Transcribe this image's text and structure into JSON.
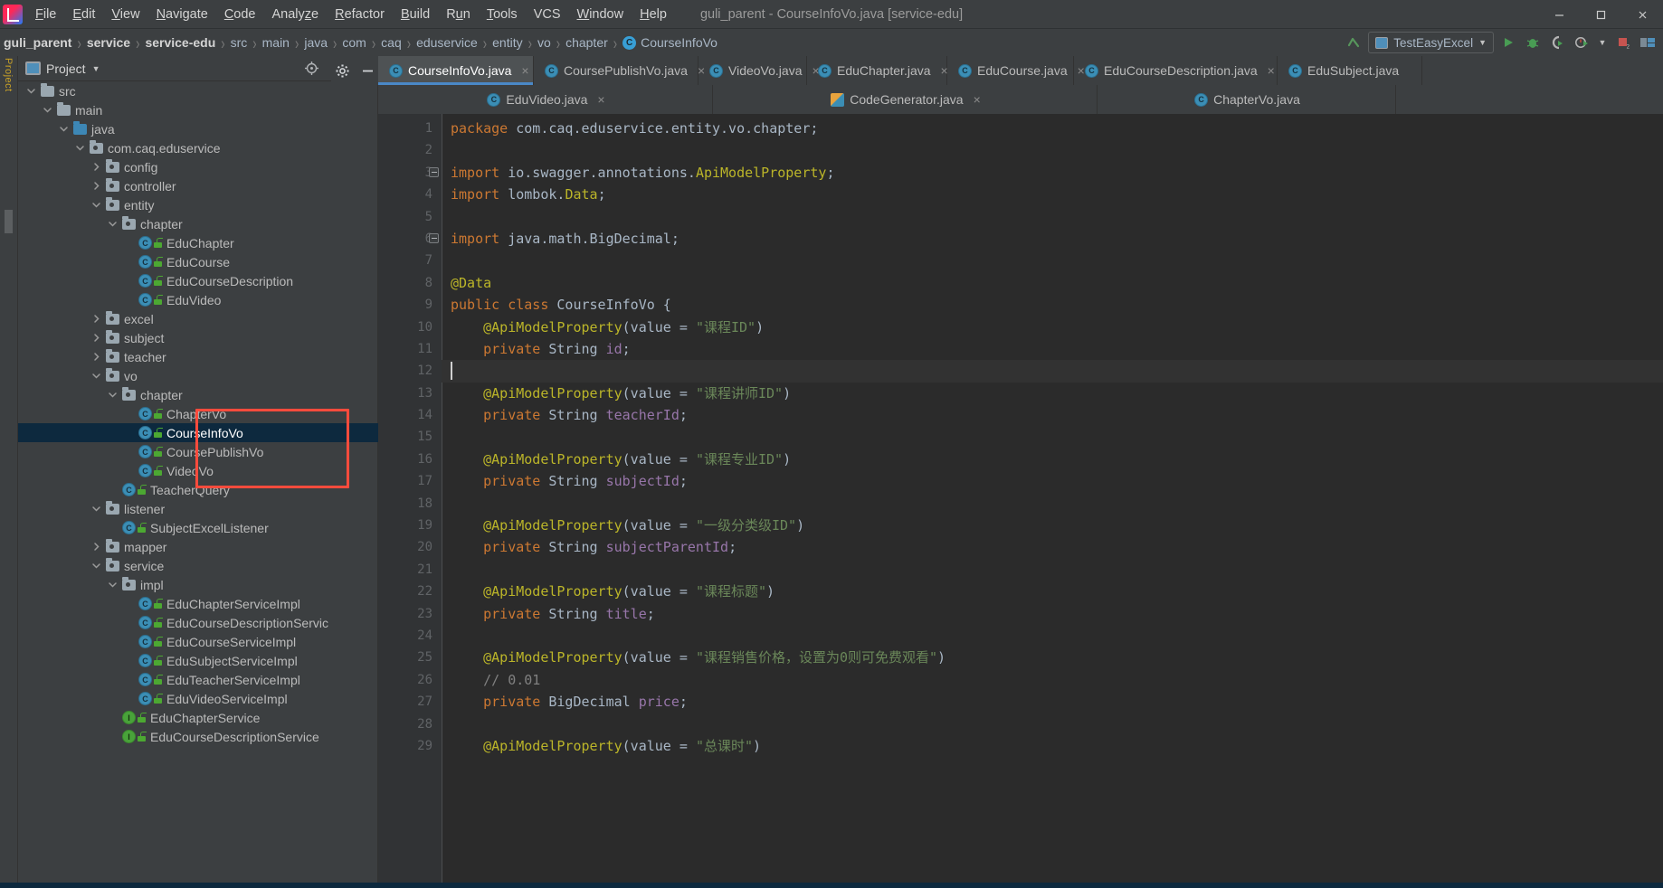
{
  "window": {
    "title": "guli_parent - CourseInfoVo.java [service-edu]",
    "logo_name": "intellij-idea-logo",
    "minimize": "minimize",
    "maximize": "maximize",
    "close": "close"
  },
  "menu": [
    {
      "label": "File",
      "mnemonic": "F"
    },
    {
      "label": "Edit",
      "mnemonic": "E"
    },
    {
      "label": "View",
      "mnemonic": "V"
    },
    {
      "label": "Navigate",
      "mnemonic": "N"
    },
    {
      "label": "Code",
      "mnemonic": "C"
    },
    {
      "label": "Analyze",
      "mnemonic": "z"
    },
    {
      "label": "Refactor",
      "mnemonic": "R"
    },
    {
      "label": "Build",
      "mnemonic": "B"
    },
    {
      "label": "Run",
      "mnemonic": "u"
    },
    {
      "label": "Tools",
      "mnemonic": "T"
    },
    {
      "label": "VCS",
      "mnemonic": ""
    },
    {
      "label": "Window",
      "mnemonic": "W"
    },
    {
      "label": "Help",
      "mnemonic": "H"
    }
  ],
  "breadcrumb": [
    {
      "label": "guli_parent",
      "bold": true,
      "icon": ""
    },
    {
      "label": "service",
      "bold": true,
      "icon": ""
    },
    {
      "label": "service-edu",
      "bold": true,
      "icon": ""
    },
    {
      "label": "src",
      "bold": false,
      "icon": ""
    },
    {
      "label": "main",
      "bold": false,
      "icon": ""
    },
    {
      "label": "java",
      "bold": false,
      "icon": ""
    },
    {
      "label": "com",
      "bold": false,
      "icon": ""
    },
    {
      "label": "caq",
      "bold": false,
      "icon": ""
    },
    {
      "label": "eduservice",
      "bold": false,
      "icon": ""
    },
    {
      "label": "entity",
      "bold": false,
      "icon": ""
    },
    {
      "label": "vo",
      "bold": false,
      "icon": ""
    },
    {
      "label": "chapter",
      "bold": false,
      "icon": ""
    },
    {
      "label": "CourseInfoVo",
      "bold": false,
      "icon": "C"
    }
  ],
  "toolbar": {
    "back_icon": "back-arrow-icon",
    "run_config": "TestEasyExcel",
    "run_config_dropdown": "chevron-down-icon",
    "run_icon": "run-icon",
    "debug_icon": "debug-icon",
    "run_coverage_icon": "run-with-coverage-icon",
    "profiler_icon": "profiler-icon",
    "profiler_dropdown": "chevron-down-icon",
    "stop_icon": "stop-icon",
    "layout_icon": "layout-icon"
  },
  "project_panel": {
    "title": "Project",
    "dropdown_icon": "chevron-down-icon",
    "panel_icon": "project-view-icon",
    "actions": [
      {
        "name": "locate-icon"
      },
      {
        "name": "expand-all-icon"
      },
      {
        "name": "collapse-all-icon"
      },
      {
        "name": "settings-gear-icon"
      },
      {
        "name": "hide-icon"
      }
    ],
    "left_strip_label": "Project"
  },
  "tree": [
    {
      "label": "src",
      "indent": 3,
      "arrow": "down",
      "icon": "folder",
      "selected": false
    },
    {
      "label": "main",
      "indent": 4,
      "arrow": "down",
      "icon": "folder",
      "selected": false
    },
    {
      "label": "java",
      "indent": 5,
      "arrow": "down",
      "icon": "folder-blue",
      "selected": false
    },
    {
      "label": "com.caq.eduservice",
      "indent": 6,
      "arrow": "down",
      "icon": "package",
      "selected": false
    },
    {
      "label": "config",
      "indent": 7,
      "arrow": "right",
      "icon": "package",
      "selected": false
    },
    {
      "label": "controller",
      "indent": 7,
      "arrow": "right",
      "icon": "package",
      "selected": false
    },
    {
      "label": "entity",
      "indent": 7,
      "arrow": "down",
      "icon": "package",
      "selected": false
    },
    {
      "label": "chapter",
      "indent": 8,
      "arrow": "down",
      "icon": "package",
      "selected": false
    },
    {
      "label": "EduChapter",
      "indent": 9,
      "arrow": "none",
      "icon": "class",
      "selected": false
    },
    {
      "label": "EduCourse",
      "indent": 9,
      "arrow": "none",
      "icon": "class",
      "selected": false
    },
    {
      "label": "EduCourseDescription",
      "indent": 9,
      "arrow": "none",
      "icon": "class",
      "selected": false
    },
    {
      "label": "EduVideo",
      "indent": 9,
      "arrow": "none",
      "icon": "class",
      "selected": false
    },
    {
      "label": "excel",
      "indent": 7,
      "arrow": "right",
      "icon": "package",
      "selected": false
    },
    {
      "label": "subject",
      "indent": 7,
      "arrow": "right",
      "icon": "package",
      "selected": false
    },
    {
      "label": "teacher",
      "indent": 7,
      "arrow": "right",
      "icon": "package",
      "selected": false
    },
    {
      "label": "vo",
      "indent": 7,
      "arrow": "down",
      "icon": "package",
      "selected": false
    },
    {
      "label": "chapter",
      "indent": 8,
      "arrow": "down",
      "icon": "package",
      "selected": false
    },
    {
      "label": "ChapterVo",
      "indent": 9,
      "arrow": "none",
      "icon": "class",
      "selected": false
    },
    {
      "label": "CourseInfoVo",
      "indent": 9,
      "arrow": "none",
      "icon": "class",
      "selected": true
    },
    {
      "label": "CoursePublishVo",
      "indent": 9,
      "arrow": "none",
      "icon": "class",
      "selected": false
    },
    {
      "label": "VideoVo",
      "indent": 9,
      "arrow": "none",
      "icon": "class",
      "selected": false
    },
    {
      "label": "TeacherQuery",
      "indent": 8,
      "arrow": "none",
      "icon": "class",
      "selected": false
    },
    {
      "label": "listener",
      "indent": 7,
      "arrow": "down",
      "icon": "package",
      "selected": false
    },
    {
      "label": "SubjectExcelListener",
      "indent": 8,
      "arrow": "none",
      "icon": "class",
      "selected": false
    },
    {
      "label": "mapper",
      "indent": 7,
      "arrow": "right",
      "icon": "package",
      "selected": false
    },
    {
      "label": "service",
      "indent": 7,
      "arrow": "down",
      "icon": "package",
      "selected": false
    },
    {
      "label": "impl",
      "indent": 8,
      "arrow": "down",
      "icon": "package",
      "selected": false
    },
    {
      "label": "EduChapterServiceImpl",
      "indent": 9,
      "arrow": "none",
      "icon": "class",
      "selected": false
    },
    {
      "label": "EduCourseDescriptionServic",
      "indent": 9,
      "arrow": "none",
      "icon": "class",
      "selected": false
    },
    {
      "label": "EduCourseServiceImpl",
      "indent": 9,
      "arrow": "none",
      "icon": "class",
      "selected": false
    },
    {
      "label": "EduSubjectServiceImpl",
      "indent": 9,
      "arrow": "none",
      "icon": "class",
      "selected": false
    },
    {
      "label": "EduTeacherServiceImpl",
      "indent": 9,
      "arrow": "none",
      "icon": "class",
      "selected": false
    },
    {
      "label": "EduVideoServiceImpl",
      "indent": 9,
      "arrow": "none",
      "icon": "class",
      "selected": false
    },
    {
      "label": "EduChapterService",
      "indent": 8,
      "arrow": "none",
      "icon": "interface",
      "selected": false
    },
    {
      "label": "EduCourseDescriptionService",
      "indent": 8,
      "arrow": "none",
      "icon": "interface",
      "selected": false
    }
  ],
  "editor_tabs_row1": [
    {
      "label": "CourseInfoVo.java",
      "icon": "class",
      "active": true,
      "close": "×"
    },
    {
      "label": "CoursePublishVo.java",
      "icon": "class",
      "active": false,
      "close": "×"
    },
    {
      "label": "VideoVo.java",
      "icon": "class",
      "active": false,
      "close": "×"
    },
    {
      "label": "EduChapter.java",
      "icon": "class",
      "active": false,
      "close": "×"
    },
    {
      "label": "EduCourse.java",
      "icon": "class",
      "active": false,
      "close": "×"
    },
    {
      "label": "EduCourseDescription.java",
      "icon": "class",
      "active": false,
      "close": "×"
    },
    {
      "label": "EduSubject.java",
      "icon": "class",
      "active": false,
      "close": ""
    }
  ],
  "editor_tabs_row2": [
    {
      "label": "EduVideo.java",
      "icon": "class",
      "active": false,
      "close": "×"
    },
    {
      "label": "CodeGenerator.java",
      "icon": "generator",
      "active": false,
      "close": "×"
    },
    {
      "label": "ChapterVo.java",
      "icon": "class",
      "active": false,
      "close": ""
    }
  ],
  "code": {
    "first_line": 1,
    "caret_line": 12,
    "fold_lines": [
      3,
      6
    ],
    "lines": [
      {
        "n": 1,
        "tokens": [
          {
            "t": "k",
            "v": "package"
          },
          {
            "t": "t",
            "v": " com.caq.eduservice.entity.vo.chapter;"
          }
        ]
      },
      {
        "n": 2,
        "tokens": []
      },
      {
        "n": 3,
        "tokens": [
          {
            "t": "k",
            "v": "import"
          },
          {
            "t": "t",
            "v": " io.swagger.annotations."
          },
          {
            "t": "an",
            "v": "ApiModelProperty"
          },
          {
            "t": "t",
            "v": ";"
          }
        ]
      },
      {
        "n": 4,
        "tokens": [
          {
            "t": "k",
            "v": "import"
          },
          {
            "t": "t",
            "v": " lombok."
          },
          {
            "t": "an",
            "v": "Data"
          },
          {
            "t": "t",
            "v": ";"
          }
        ]
      },
      {
        "n": 5,
        "tokens": []
      },
      {
        "n": 6,
        "tokens": [
          {
            "t": "k",
            "v": "import"
          },
          {
            "t": "t",
            "v": " java.math.BigDecimal;"
          }
        ]
      },
      {
        "n": 7,
        "tokens": []
      },
      {
        "n": 8,
        "tokens": [
          {
            "t": "an",
            "v": "@Data"
          }
        ]
      },
      {
        "n": 9,
        "tokens": [
          {
            "t": "k",
            "v": "public class "
          },
          {
            "t": "t",
            "v": "CourseInfoVo {"
          }
        ]
      },
      {
        "n": 10,
        "tokens": [
          {
            "t": "t",
            "v": "    "
          },
          {
            "t": "an",
            "v": "@ApiModelProperty"
          },
          {
            "t": "t",
            "v": "(value = "
          },
          {
            "t": "s",
            "v": "\"课程ID\""
          },
          {
            "t": "t",
            "v": ")"
          }
        ]
      },
      {
        "n": 11,
        "tokens": [
          {
            "t": "t",
            "v": "    "
          },
          {
            "t": "k",
            "v": "private "
          },
          {
            "t": "t",
            "v": "String "
          },
          {
            "t": "f",
            "v": "id"
          },
          {
            "t": "t",
            "v": ";"
          }
        ]
      },
      {
        "n": 12,
        "tokens": []
      },
      {
        "n": 13,
        "tokens": [
          {
            "t": "t",
            "v": "    "
          },
          {
            "t": "an",
            "v": "@ApiModelProperty"
          },
          {
            "t": "t",
            "v": "(value = "
          },
          {
            "t": "s",
            "v": "\"课程讲师ID\""
          },
          {
            "t": "t",
            "v": ")"
          }
        ]
      },
      {
        "n": 14,
        "tokens": [
          {
            "t": "t",
            "v": "    "
          },
          {
            "t": "k",
            "v": "private "
          },
          {
            "t": "t",
            "v": "String "
          },
          {
            "t": "f",
            "v": "teacherId"
          },
          {
            "t": "t",
            "v": ";"
          }
        ]
      },
      {
        "n": 15,
        "tokens": []
      },
      {
        "n": 16,
        "tokens": [
          {
            "t": "t",
            "v": "    "
          },
          {
            "t": "an",
            "v": "@ApiModelProperty"
          },
          {
            "t": "t",
            "v": "(value = "
          },
          {
            "t": "s",
            "v": "\"课程专业ID\""
          },
          {
            "t": "t",
            "v": ")"
          }
        ]
      },
      {
        "n": 17,
        "tokens": [
          {
            "t": "t",
            "v": "    "
          },
          {
            "t": "k",
            "v": "private "
          },
          {
            "t": "t",
            "v": "String "
          },
          {
            "t": "f",
            "v": "subjectId"
          },
          {
            "t": "t",
            "v": ";"
          }
        ]
      },
      {
        "n": 18,
        "tokens": []
      },
      {
        "n": 19,
        "tokens": [
          {
            "t": "t",
            "v": "    "
          },
          {
            "t": "an",
            "v": "@ApiModelProperty"
          },
          {
            "t": "t",
            "v": "(value = "
          },
          {
            "t": "s",
            "v": "\"一级分类级ID\""
          },
          {
            "t": "t",
            "v": ")"
          }
        ]
      },
      {
        "n": 20,
        "tokens": [
          {
            "t": "t",
            "v": "    "
          },
          {
            "t": "k",
            "v": "private "
          },
          {
            "t": "t",
            "v": "String "
          },
          {
            "t": "f",
            "v": "subjectParentId"
          },
          {
            "t": "t",
            "v": ";"
          }
        ]
      },
      {
        "n": 21,
        "tokens": []
      },
      {
        "n": 22,
        "tokens": [
          {
            "t": "t",
            "v": "    "
          },
          {
            "t": "an",
            "v": "@ApiModelProperty"
          },
          {
            "t": "t",
            "v": "(value = "
          },
          {
            "t": "s",
            "v": "\"课程标题\""
          },
          {
            "t": "t",
            "v": ")"
          }
        ]
      },
      {
        "n": 23,
        "tokens": [
          {
            "t": "t",
            "v": "    "
          },
          {
            "t": "k",
            "v": "private "
          },
          {
            "t": "t",
            "v": "String "
          },
          {
            "t": "f",
            "v": "title"
          },
          {
            "t": "t",
            "v": ";"
          }
        ]
      },
      {
        "n": 24,
        "tokens": []
      },
      {
        "n": 25,
        "tokens": [
          {
            "t": "t",
            "v": "    "
          },
          {
            "t": "an",
            "v": "@ApiModelProperty"
          },
          {
            "t": "t",
            "v": "(value = "
          },
          {
            "t": "s",
            "v": "\"课程销售价格，设置为0则可免费观看\""
          },
          {
            "t": "t",
            "v": ")"
          }
        ]
      },
      {
        "n": 26,
        "tokens": [
          {
            "t": "t",
            "v": "    "
          },
          {
            "t": "cm",
            "v": "// 0.01"
          }
        ]
      },
      {
        "n": 27,
        "tokens": [
          {
            "t": "t",
            "v": "    "
          },
          {
            "t": "k",
            "v": "private "
          },
          {
            "t": "t",
            "v": "BigDecimal "
          },
          {
            "t": "f",
            "v": "price"
          },
          {
            "t": "t",
            "v": ";"
          }
        ]
      },
      {
        "n": 28,
        "tokens": []
      },
      {
        "n": 29,
        "tokens": [
          {
            "t": "t",
            "v": "    "
          },
          {
            "t": "an",
            "v": "@ApiModelProperty"
          },
          {
            "t": "t",
            "v": "(value = "
          },
          {
            "t": "s",
            "v": "\"总课时\""
          },
          {
            "t": "t",
            "v": ")"
          }
        ]
      }
    ]
  },
  "annotation": {
    "red_highlight_color": "#fe4b3c",
    "selection_color": "#0d293e",
    "accent_color": "#4a88c7"
  }
}
